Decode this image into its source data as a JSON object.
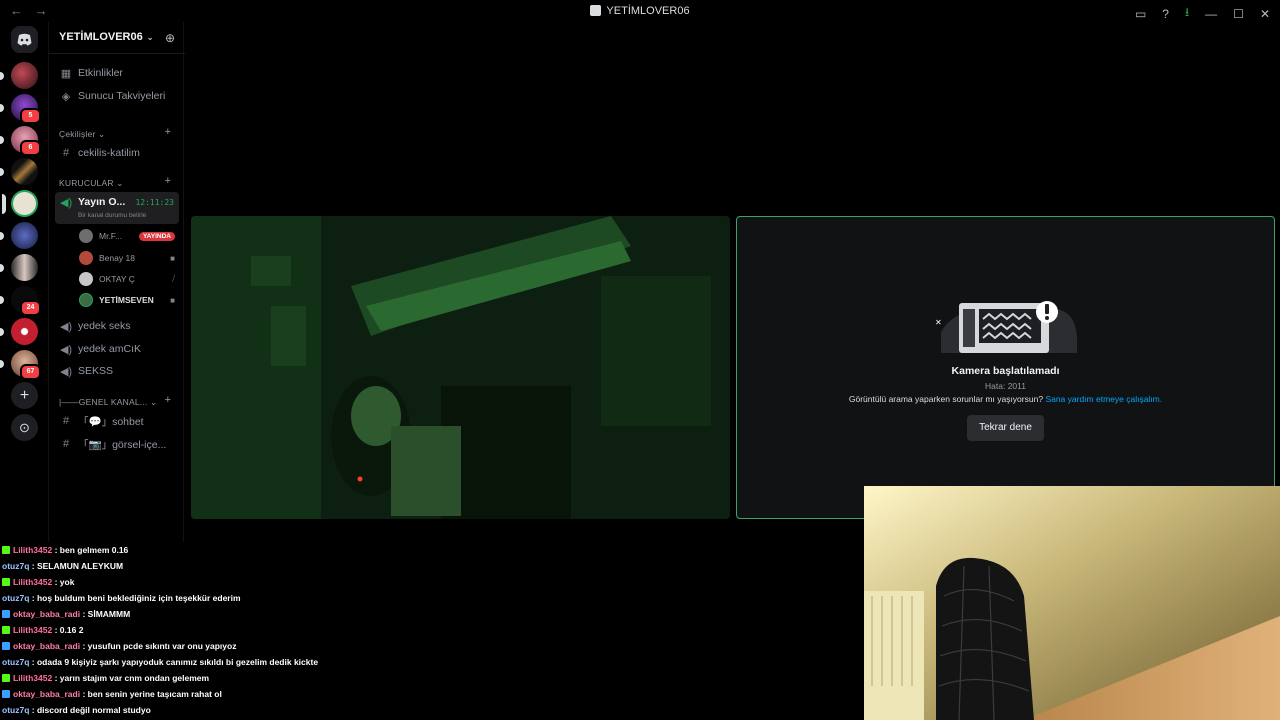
{
  "titlebar": {
    "back": "←",
    "forward": "→",
    "title": "YETİMLOVER06",
    "controls": [
      "▭",
      "?",
      "⭳",
      "—",
      "☐",
      "✕"
    ]
  },
  "rail": {
    "servers": [
      {
        "badge": ""
      },
      {
        "badge": "5"
      },
      {
        "badge": "6"
      },
      {
        "badge": ""
      },
      {
        "badge": ""
      },
      {
        "badge": ""
      },
      {
        "badge": ""
      },
      {
        "badge": "24"
      },
      {
        "badge": ""
      },
      {
        "badge": "67"
      }
    ],
    "add_label": "+",
    "discover_label": "⊙"
  },
  "sidebar": {
    "server_name": "YETİMLOVER06",
    "events": "Etkinlikler",
    "boosts": "Sunucu Takviyeleri",
    "cat_cekilisler": "Çekilişler",
    "ch_cekilis": "cekilis-katilim",
    "cat_kurucular": "KURUCULAR",
    "active_channel": {
      "name": "Yayın O...",
      "timer": "12:11:23",
      "status": "Bir kanal durumu belirle"
    },
    "users": [
      {
        "name": "Mr.F...",
        "tag": "YAYINDA"
      },
      {
        "name": "Benay 18",
        "tag": ""
      },
      {
        "name": "OKTAY Ç",
        "tag": ""
      },
      {
        "name": "YETİMSEVEN",
        "tag": ""
      }
    ],
    "voice_channels": [
      "yedek seks",
      "yedek amCıK",
      "SEKSS"
    ],
    "cat_genel": "|——GENEL KANAL...",
    "text_channels": [
      "「💬」sohbet",
      "「📷」görsel-içe..."
    ]
  },
  "error_tile": {
    "title": "Kamera başlatılamadı",
    "code": "Hata: 2011",
    "help_text": "Görüntülü arama yaparken sorunlar mı yaşıyorsun?",
    "help_link": "Sana yardım etmeye çalışalım.",
    "retry": "Tekrar dene"
  },
  "chat": [
    {
      "user": "Lilith3452",
      "msg": ": ben gelmem 0.16",
      "platform": "tw",
      "color": "lilith"
    },
    {
      "user": "otuz7q",
      "msg": ": SELAMUN ALEYKUM",
      "platform": "",
      "color": "otuz"
    },
    {
      "user": "Lilith3452",
      "msg": ": yok",
      "platform": "tw",
      "color": "lilith"
    },
    {
      "user": "otuz7q",
      "msg": ": hoş buldum beni beklediğiniz için teşekkür ederim",
      "platform": "",
      "color": "otuz"
    },
    {
      "user": "oktay_baba_radi",
      "msg": ": SİMAMMM",
      "platform": "kick",
      "color": "oktay"
    },
    {
      "user": "Lilith3452",
      "msg": ": 0.16 2",
      "platform": "tw",
      "color": "lilith"
    },
    {
      "user": "oktay_baba_radi",
      "msg": ": yusufun pcde sıkıntı var onu yapıyoz",
      "platform": "kick",
      "color": "oktay"
    },
    {
      "user": "otuz7q",
      "msg": ": odada 9 kişiyiz şarkı yapıyoduk canımız sıkıldı bi gezelim dedik kickte",
      "platform": "",
      "color": "otuz"
    },
    {
      "user": "Lilith3452",
      "msg": ": yarın stajım var cnm ondan gelemem",
      "platform": "tw",
      "color": "lilith"
    },
    {
      "user": "oktay_baba_radi",
      "msg": ": ben senin yerine taşıcam rahat ol",
      "platform": "kick",
      "color": "oktay"
    },
    {
      "user": "otuz7q",
      "msg": ": discord değil normal studyo",
      "platform": "",
      "color": "otuz"
    }
  ]
}
